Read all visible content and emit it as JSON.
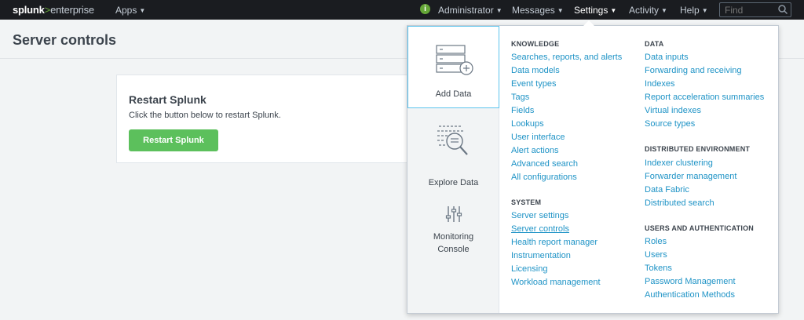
{
  "topbar": {
    "logo_brand": "splunk",
    "logo_gt": ">",
    "logo_product": "enterprise",
    "apps": "Apps",
    "status_icon": "i",
    "administrator": "Administrator",
    "messages": "Messages",
    "settings": "Settings",
    "activity": "Activity",
    "help": "Help",
    "find_placeholder": "Find"
  },
  "page": {
    "title": "Server controls"
  },
  "panel": {
    "title": "Restart Splunk",
    "description": "Click the button below to restart Splunk.",
    "button": "Restart Splunk"
  },
  "dropdown": {
    "side": [
      {
        "label": "Add Data",
        "icon": "add-data-icon"
      },
      {
        "label": "Explore Data",
        "icon": "explore-data-icon"
      },
      {
        "label_line1": "Monitoring",
        "label_line2": "Console",
        "icon": "monitoring-console-icon"
      }
    ],
    "knowledge": {
      "title": "KNOWLEDGE",
      "items": [
        "Searches, reports, and alerts",
        "Data models",
        "Event types",
        "Tags",
        "Fields",
        "Lookups",
        "User interface",
        "Alert actions",
        "Advanced search",
        "All configurations"
      ]
    },
    "system": {
      "title": "SYSTEM",
      "items": [
        "Server settings",
        "Server controls",
        "Health report manager",
        "Instrumentation",
        "Licensing",
        "Workload management"
      ]
    },
    "data": {
      "title": "DATA",
      "items": [
        "Data inputs",
        "Forwarding and receiving",
        "Indexes",
        "Report acceleration summaries",
        "Virtual indexes",
        "Source types"
      ]
    },
    "distributed": {
      "title": "DISTRIBUTED ENVIRONMENT",
      "items": [
        "Indexer clustering",
        "Forwarder management",
        "Data Fabric",
        "Distributed search"
      ]
    },
    "users": {
      "title": "USERS AND AUTHENTICATION",
      "items": [
        "Roles",
        "Users",
        "Tokens",
        "Password Management",
        "Authentication Methods"
      ]
    }
  },
  "colors": {
    "topbar_bg": "#1a1c20",
    "brand_green": "#65a637",
    "button_green": "#5cc05c",
    "link_blue": "#1e93c6",
    "active_border": "#5cc4ed"
  }
}
